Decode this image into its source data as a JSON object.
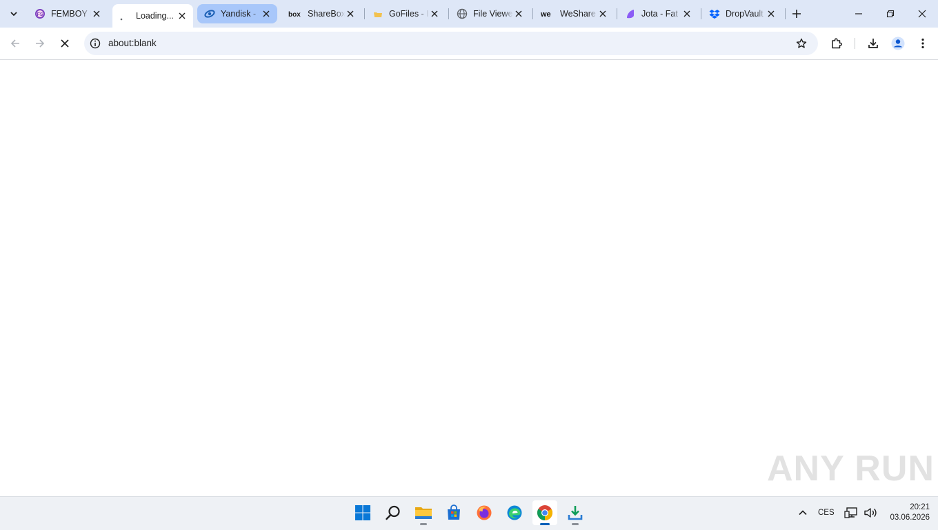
{
  "browser": {
    "tabs": [
      {
        "title": "FEMBOY I",
        "favicon": "fs-icon"
      },
      {
        "title": "Loading...",
        "favicon": "loading-dot-icon",
        "active": true
      },
      {
        "title": "Yandisk -",
        "favicon": "yandisk-icon"
      },
      {
        "title": "ShareBox",
        "favicon": "box-icon"
      },
      {
        "title": "GoFiles - I",
        "favicon": "folder-icon"
      },
      {
        "title": "File Viewe",
        "favicon": "globe-icon"
      },
      {
        "title": "WeShare",
        "favicon": "we-icon"
      },
      {
        "title": "Jota - Fat",
        "favicon": "jota-icon"
      },
      {
        "title": "DropVault",
        "favicon": "dropbox-icon"
      }
    ],
    "address": {
      "url": "about:blank"
    }
  },
  "taskbar": {
    "apps": [
      "start-icon",
      "search-icon",
      "file-explorer-icon",
      "store-icon",
      "firefox-icon",
      "edge-icon",
      "chrome-icon",
      "downloads-icon"
    ],
    "tray": {
      "language": "CES",
      "time": "20:21",
      "date": "03.06.2026"
    }
  },
  "watermark": "ANY RUN",
  "colors": {
    "tabstrip": "#dee7f7",
    "tab_group": "#a8c7fa",
    "omnibox": "#eef2fa",
    "taskbar": "#eef1f5",
    "accent": "#005fb8"
  }
}
